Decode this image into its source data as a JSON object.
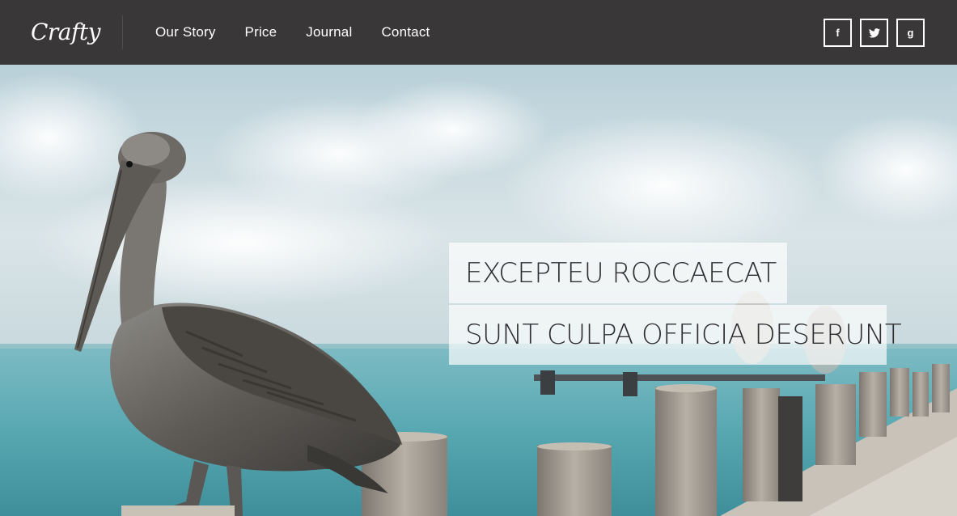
{
  "header": {
    "logo": "Crafty",
    "nav": [
      "Our Story",
      "Price",
      "Journal",
      "Contact"
    ],
    "social": [
      {
        "icon": "facebook-icon",
        "glyph": "f"
      },
      {
        "icon": "twitter-icon",
        "glyph": ""
      },
      {
        "icon": "google-plus-icon",
        "glyph": "g"
      }
    ]
  },
  "hero": {
    "line1": "EXCEPTEU ROCCAECAT",
    "line2": "SUNT CULPA OFFICIA DESERUNT"
  },
  "colors": {
    "header_bg": "#3a3738",
    "caption_bg": "rgba(255,255,255,0.68)",
    "caption_text": "#2f2f33"
  }
}
